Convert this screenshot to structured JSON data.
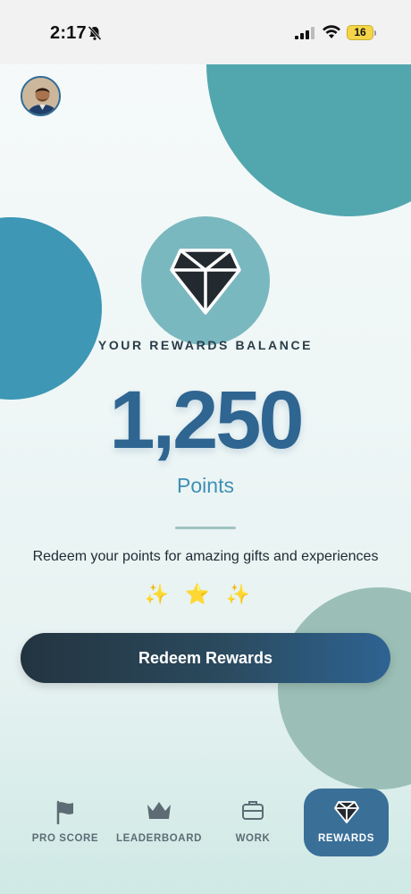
{
  "status_bar": {
    "time": "2:17",
    "battery": "16"
  },
  "hero": {
    "balance_label": "YOUR REWARDS BALANCE",
    "balance_value": "1,250",
    "balance_unit": "Points",
    "tagline": "Redeem your points for amazing gifts and experiences",
    "emojis": "✨⭐✨"
  },
  "actions": {
    "redeem_label": "Redeem Rewards"
  },
  "tab_bar": {
    "tabs": [
      {
        "label": "PRO SCORE",
        "icon": "flag-icon"
      },
      {
        "label": "LEADERBOARD",
        "icon": "crown-icon"
      },
      {
        "label": "WORK",
        "icon": "briefcase-icon"
      },
      {
        "label": "REWARDS",
        "icon": "diamond-icon",
        "active": true
      }
    ]
  },
  "colors": {
    "accent": "#2f6591",
    "active_tab": "#3a6f98",
    "circle_teal": "#52a6ae",
    "circle_blue": "#3d97b5",
    "circle_sage": "#9bbfb6"
  }
}
